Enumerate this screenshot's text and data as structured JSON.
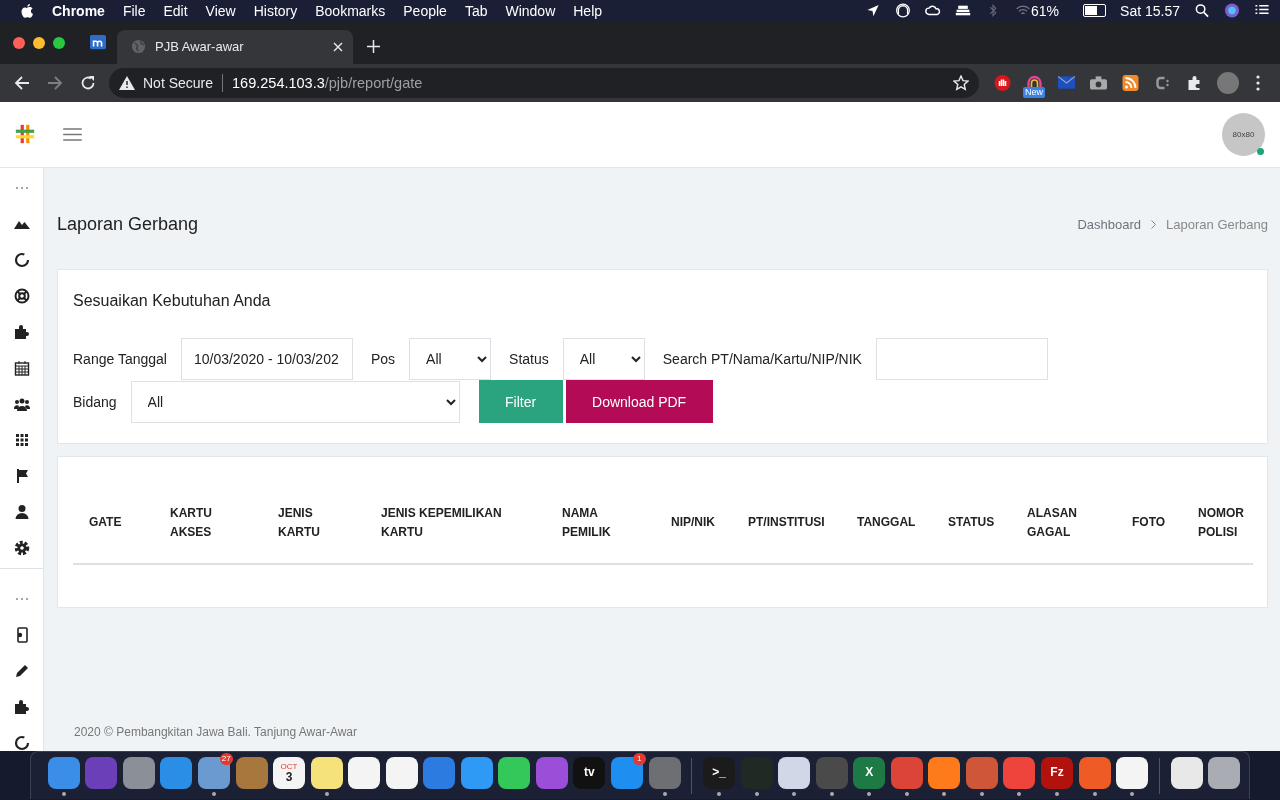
{
  "menu_bar": {
    "app": "Chrome",
    "menus": [
      "File",
      "Edit",
      "View",
      "History",
      "Bookmarks",
      "People",
      "Tab",
      "Window",
      "Help"
    ],
    "battery": {
      "text": "61%",
      "level": 0.61
    },
    "clock": "Sat 15.57"
  },
  "browser": {
    "tabs": [
      {
        "title": "PJB Awar-awar",
        "selected": true
      }
    ],
    "security": "Not Secure",
    "url_host": "169.254.103.3",
    "url_path": "/pjb/report/gate",
    "forward_disabled": true,
    "extension_badge": "New"
  },
  "header": {
    "avatar_text": "80x80",
    "online": true
  },
  "page": {
    "title": "Laporan Gerbang",
    "breadcrumb": [
      {
        "label": "Dashboard",
        "current": false
      },
      {
        "label": "Laporan Gerbang",
        "current": true
      }
    ]
  },
  "filter": {
    "title": "Sesuaikan Kebutuhan Anda",
    "range_label": "Range Tanggal",
    "range_value": "10/03/2020 - 10/03/202",
    "pos_label": "Pos",
    "pos_value": "All",
    "status_label": "Status",
    "status_value": "All",
    "search_label": "Search PT/Nama/Kartu/NIP/NIK",
    "bidang_label": "Bidang",
    "bidang_value": "All",
    "filter_button": "Filter",
    "pdf_button": "Download PDF"
  },
  "table": {
    "columns": [
      {
        "lines": [
          "GATE"
        ]
      },
      {
        "lines": [
          "KARTU",
          "AKSES"
        ]
      },
      {
        "lines": [
          "JENIS",
          "KARTU"
        ]
      },
      {
        "lines": [
          "JENIS KEPEMILIKAN",
          "KARTU"
        ]
      },
      {
        "lines": [
          "NAMA",
          "PEMILIK"
        ]
      },
      {
        "lines": [
          "NIP/NIK"
        ]
      },
      {
        "lines": [
          "PT/INSTITUSI"
        ]
      },
      {
        "lines": [
          "TANGGAL"
        ]
      },
      {
        "lines": [
          "STATUS"
        ]
      },
      {
        "lines": [
          "ALASAN",
          "GAGAL"
        ]
      },
      {
        "lines": [
          "FOTO"
        ]
      },
      {
        "lines": [
          "NOMOR",
          "POLISI"
        ]
      }
    ]
  },
  "footer": "2020 © Pembangkitan Jawa Bali. Tanjung Awar-Awar",
  "dock": [
    {
      "running": true
    },
    {
      "running": false
    },
    {
      "running": false
    },
    {
      "running": false
    },
    {
      "running": true,
      "badge": "27"
    },
    {
      "running": false
    },
    {
      "running": false,
      "month": "OCT",
      "text": "3"
    },
    {
      "running": true
    },
    {
      "running": false
    },
    {
      "running": false
    },
    {
      "running": false
    },
    {
      "running": false
    },
    {
      "running": false
    },
    {
      "running": false
    },
    {
      "running": false,
      "text": "tv"
    },
    {
      "running": false,
      "badge": "1"
    },
    {
      "running": true
    },
    {
      "running": true,
      "text": ">_"
    },
    {
      "running": true
    },
    {
      "running": true
    },
    {
      "running": true
    },
    {
      "running": true,
      "text": "X"
    },
    {
      "running": true
    },
    {
      "running": true
    },
    {
      "running": true
    },
    {
      "running": true
    },
    {
      "running": true,
      "text": "Fz"
    },
    {
      "running": true
    },
    {
      "running": true
    },
    {
      "running": false
    },
    {
      "running": false
    }
  ]
}
